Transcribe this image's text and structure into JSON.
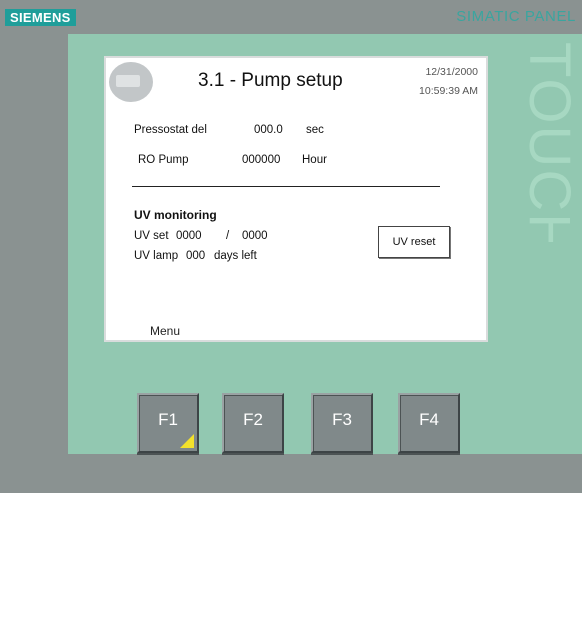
{
  "device": {
    "brand": "SIEMENS",
    "product": "SIMATIC PANEL",
    "bezel_text": "TOUCH",
    "colors": {
      "bezel": "#92c8b1",
      "frame": "#8a9291",
      "brand": "#1f9e9a",
      "key_marker": "#f3e12b"
    }
  },
  "screen": {
    "title": "3.1 - Pump setup",
    "date": "12/31/2000",
    "time": "10:59:39 AM",
    "logo_icon": "company-logo-icon",
    "rows": [
      {
        "label": "Pressostat del",
        "value": "000.0",
        "unit": "sec"
      },
      {
        "label": "RO Pump",
        "value": "000000",
        "unit": "Hour"
      }
    ],
    "uv": {
      "heading": "UV monitoring",
      "set_label": "UV set",
      "set_value": "0000",
      "separator": "/",
      "set_limit": "0000",
      "lamp_label": "UV lamp",
      "lamp_value": "000",
      "lamp_suffix": "days left",
      "reset_button": "UV reset"
    },
    "menu": "Menu"
  },
  "function_keys": [
    "F1",
    "F2",
    "F3",
    "F4"
  ]
}
